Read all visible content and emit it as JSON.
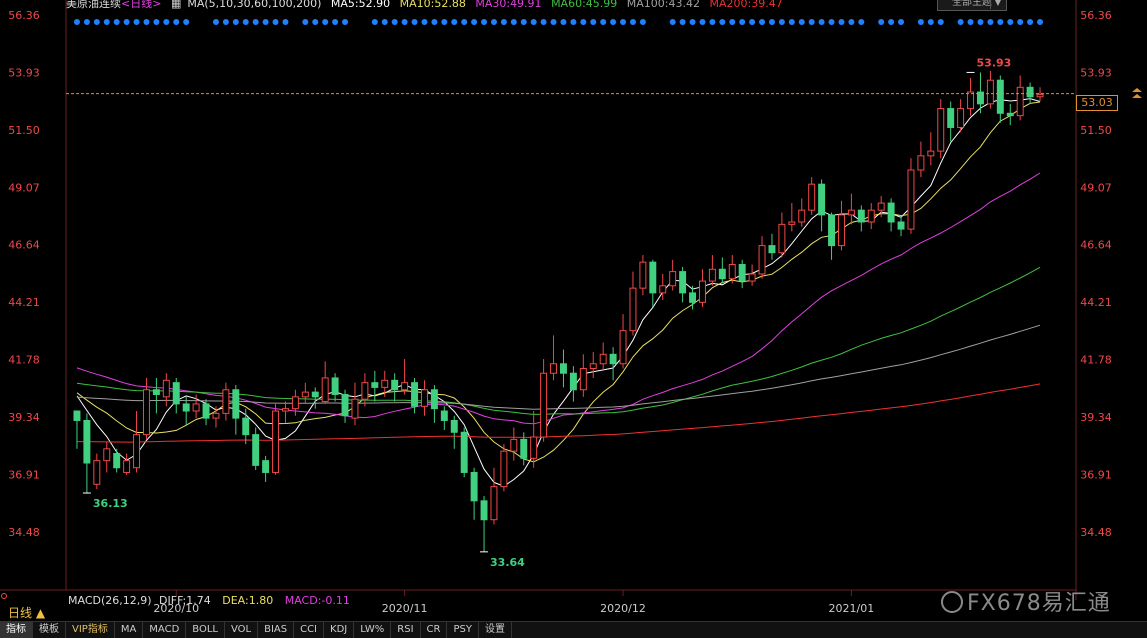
{
  "header": {
    "title": "美原油连续",
    "period_tag": "<日线>",
    "ma_params": "MA(5,10,30,60,100,200)",
    "ma5": "MA5:52.90",
    "ma10": "MA10:52.88",
    "ma30": "MA30:49.91",
    "ma60": "MA60:45.99",
    "ma100": "MA100:43.42",
    "ma200": "MA200:39.47",
    "theme_button": "全部主题"
  },
  "colors": {
    "up": "#f04848",
    "down": "#40d080",
    "ma5": "#ffffff",
    "ma10": "#e8e060",
    "ma30": "#e040e0",
    "ma60": "#40c040",
    "ma100": "#a0a0a0",
    "ma200": "#f03030",
    "axis_text": "#f04848",
    "dot": "#2080ff"
  },
  "chart_data": {
    "type": "candlestick",
    "y_ticks": [
      "56.36",
      "53.93",
      "51.50",
      "49.07",
      "46.64",
      "44.21",
      "41.78",
      "39.34",
      "36.91",
      "34.48"
    ],
    "ylim": [
      33.0,
      56.36
    ],
    "x_labels": [
      "2020/10",
      "2020/11",
      "2020/12",
      "2021/01"
    ],
    "x_label_index": [
      10,
      33,
      55,
      78
    ],
    "last_price": "53.03",
    "annotations": [
      {
        "text": "36.13",
        "index": 1,
        "value": 36.13,
        "color": "#40d080"
      },
      {
        "text": "33.64",
        "index": 41,
        "value": 33.64,
        "color": "#40d080"
      },
      {
        "text": "53.93",
        "index": 90,
        "value": 53.93,
        "color": "#f04848"
      }
    ],
    "candles": [
      [
        39.6,
        39.2,
        39.6,
        38.0
      ],
      [
        39.2,
        37.4,
        39.5,
        36.1
      ],
      [
        36.5,
        37.5,
        37.8,
        36.3
      ],
      [
        37.5,
        38.0,
        38.3,
        37.0
      ],
      [
        37.8,
        37.2,
        38.0,
        37.0
      ],
      [
        37.0,
        37.5,
        37.8,
        36.9
      ],
      [
        37.2,
        38.6,
        39.6,
        37.0
      ],
      [
        38.6,
        40.5,
        41.0,
        38.4
      ],
      [
        40.5,
        40.3,
        41.0,
        39.5
      ],
      [
        40.2,
        40.9,
        41.2,
        39.8
      ],
      [
        40.8,
        39.9,
        41.0,
        39.5
      ],
      [
        39.9,
        39.6,
        40.2,
        39.0
      ],
      [
        39.6,
        39.9,
        40.3,
        39.3
      ],
      [
        39.9,
        39.3,
        40.1,
        39.0
      ],
      [
        39.3,
        39.5,
        39.8,
        38.9
      ],
      [
        39.5,
        40.5,
        40.8,
        39.2
      ],
      [
        40.5,
        39.3,
        40.7,
        38.6
      ],
      [
        39.3,
        38.6,
        39.7,
        38.2
      ],
      [
        38.6,
        37.3,
        38.9,
        37.1
      ],
      [
        37.5,
        37.0,
        37.7,
        36.6
      ],
      [
        37.0,
        39.6,
        39.9,
        36.9
      ],
      [
        39.6,
        39.7,
        40.0,
        39.1
      ],
      [
        39.7,
        40.2,
        40.5,
        39.4
      ],
      [
        40.2,
        40.4,
        40.8,
        39.9
      ],
      [
        40.4,
        40.2,
        40.6,
        39.7
      ],
      [
        40.0,
        41.0,
        41.7,
        39.9
      ],
      [
        41.0,
        40.3,
        41.2,
        40.0
      ],
      [
        40.3,
        39.4,
        40.5,
        39.1
      ],
      [
        39.3,
        40.1,
        40.8,
        39.0
      ],
      [
        40.1,
        40.8,
        41.2,
        39.8
      ],
      [
        40.8,
        40.6,
        41.3,
        40.0
      ],
      [
        40.6,
        40.9,
        41.3,
        40.2
      ],
      [
        40.9,
        40.5,
        41.2,
        40.0
      ],
      [
        40.5,
        40.8,
        41.8,
        40.3
      ],
      [
        40.8,
        39.8,
        41.0,
        39.5
      ],
      [
        39.8,
        40.5,
        40.9,
        39.4
      ],
      [
        40.5,
        39.7,
        40.7,
        39.1
      ],
      [
        39.6,
        39.2,
        39.8,
        38.8
      ],
      [
        39.2,
        38.7,
        39.4,
        38.0
      ],
      [
        38.7,
        37.0,
        38.9,
        36.8
      ],
      [
        37.0,
        35.8,
        37.2,
        35.0
      ],
      [
        35.8,
        35.0,
        36.0,
        33.64
      ],
      [
        35.0,
        36.4,
        37.2,
        34.8
      ],
      [
        36.4,
        37.9,
        38.2,
        36.2
      ],
      [
        37.9,
        38.4,
        38.9,
        37.5
      ],
      [
        38.4,
        37.6,
        38.7,
        37.3
      ],
      [
        37.6,
        38.5,
        39.6,
        37.2
      ],
      [
        38.5,
        41.2,
        41.8,
        38.3
      ],
      [
        41.2,
        41.6,
        42.8,
        40.9
      ],
      [
        41.6,
        41.2,
        42.2,
        40.6
      ],
      [
        41.2,
        40.5,
        41.5,
        40.0
      ],
      [
        40.5,
        41.4,
        42.0,
        40.2
      ],
      [
        41.4,
        41.6,
        42.1,
        41.0
      ],
      [
        41.6,
        42.0,
        42.5,
        41.3
      ],
      [
        42.0,
        41.6,
        42.3,
        40.9
      ],
      [
        41.6,
        43.0,
        43.7,
        41.4
      ],
      [
        43.0,
        44.8,
        45.5,
        42.8
      ],
      [
        44.8,
        45.9,
        46.2,
        44.5
      ],
      [
        45.9,
        44.6,
        46.0,
        44.0
      ],
      [
        44.6,
        44.9,
        45.4,
        44.3
      ],
      [
        44.9,
        45.5,
        46.0,
        44.7
      ],
      [
        45.5,
        44.6,
        45.7,
        44.2
      ],
      [
        44.6,
        44.2,
        44.9,
        43.9
      ],
      [
        44.2,
        45.1,
        45.6,
        44.0
      ],
      [
        45.1,
        45.6,
        46.2,
        44.9
      ],
      [
        45.6,
        45.2,
        46.1,
        45.0
      ],
      [
        45.2,
        45.8,
        46.2,
        45.0
      ],
      [
        45.8,
        45.1,
        46.0,
        44.8
      ],
      [
        45.1,
        45.4,
        45.8,
        44.9
      ],
      [
        45.4,
        46.6,
        47.0,
        45.2
      ],
      [
        46.6,
        46.3,
        47.1,
        46.0
      ],
      [
        46.3,
        47.5,
        48.0,
        46.1
      ],
      [
        47.5,
        47.6,
        48.4,
        47.2
      ],
      [
        47.6,
        48.1,
        48.6,
        47.4
      ],
      [
        48.1,
        49.2,
        49.5,
        47.9
      ],
      [
        49.2,
        47.9,
        49.4,
        47.2
      ],
      [
        47.9,
        46.6,
        48.0,
        46.0
      ],
      [
        46.6,
        47.9,
        48.5,
        46.4
      ],
      [
        47.9,
        48.1,
        48.8,
        47.5
      ],
      [
        48.1,
        47.6,
        48.3,
        47.2
      ],
      [
        47.6,
        48.1,
        48.4,
        47.3
      ],
      [
        48.1,
        48.4,
        48.7,
        47.8
      ],
      [
        48.4,
        47.6,
        48.6,
        47.2
      ],
      [
        47.6,
        47.3,
        47.9,
        47.0
      ],
      [
        47.3,
        49.8,
        50.3,
        47.1
      ],
      [
        49.8,
        50.4,
        51.0,
        49.5
      ],
      [
        50.4,
        50.6,
        51.4,
        50.0
      ],
      [
        50.6,
        52.4,
        52.8,
        50.3
      ],
      [
        52.4,
        51.6,
        52.7,
        51.0
      ],
      [
        51.6,
        52.4,
        52.8,
        51.4
      ],
      [
        52.4,
        53.1,
        53.7,
        52.1
      ],
      [
        53.1,
        52.6,
        53.93,
        52.2
      ],
      [
        52.6,
        53.6,
        54.0,
        52.4
      ],
      [
        53.6,
        52.2,
        53.8,
        51.8
      ],
      [
        52.2,
        52.1,
        52.6,
        51.7
      ],
      [
        52.1,
        53.3,
        53.8,
        51.9
      ],
      [
        53.3,
        52.9,
        53.5,
        52.6
      ],
      [
        52.9,
        53.0,
        53.3,
        52.7
      ]
    ]
  },
  "macd": {
    "label": "MACD(26,12,9)",
    "diff": "DIFF:1.74",
    "dea": "DEA:1.80",
    "macd": "MACD:-0.11"
  },
  "period_label": "日线 ▲",
  "watermark": "FX678易汇通",
  "bottom_tabs": [
    "指标",
    "模板",
    "VIP指标",
    "MA",
    "MACD",
    "BOLL",
    "VOL",
    "BIAS",
    "CCI",
    "KDJ",
    "LW%",
    "RSI",
    "CR",
    "PSY",
    "设置"
  ]
}
